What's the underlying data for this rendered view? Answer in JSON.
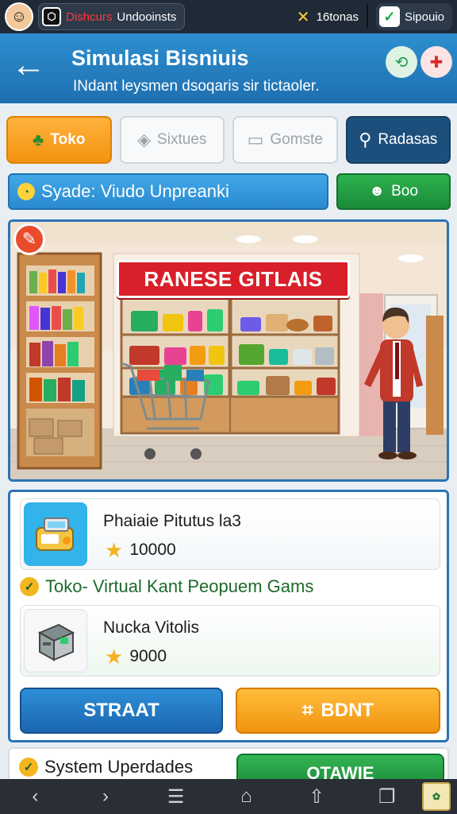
{
  "status_bar": {
    "app_name_red": "Dishcurs",
    "app_name_white": "Undooinsts",
    "tool_text": "16tonas",
    "right_text": "Sipouio"
  },
  "header": {
    "title": "Simulasi Bisniuis",
    "subtitle": "INdant leysmen dsoqaris sir tictaoler."
  },
  "tabs": [
    {
      "label": "Toko",
      "icon": "tree-icon",
      "state": "active"
    },
    {
      "label": "Sixtues",
      "icon": "box-icon",
      "state": "inactive"
    },
    {
      "label": "Gomste",
      "icon": "monitor-icon",
      "state": "inactive"
    },
    {
      "label": "Radasas",
      "icon": "search-icon",
      "state": "dark"
    }
  ],
  "info_bar": {
    "text": "Syade: Viudo Unpreanki"
  },
  "boo_button": {
    "label": "Boo"
  },
  "scene": {
    "sign_text": "RANESE GITLAIS"
  },
  "products": [
    {
      "title": "Phaiaie Pitutus la3",
      "price": "10000",
      "icon": "cash-register-icon"
    },
    {
      "title": "Nucka Vitolis",
      "price": "9000",
      "icon": "machine-icon"
    }
  ],
  "section_title": "Toko- Virtual Kant Peopuem Gams",
  "buttons": {
    "start": "STRAAT",
    "bdnt": "BDNT"
  },
  "bottom": {
    "label": "System Uperdades",
    "green_button": "OTAWIE"
  },
  "colors": {
    "header_blue": "#1f6fb0",
    "accent_orange": "#f39311",
    "accent_green": "#1a8a39",
    "status_dark": "#1f2a36"
  }
}
